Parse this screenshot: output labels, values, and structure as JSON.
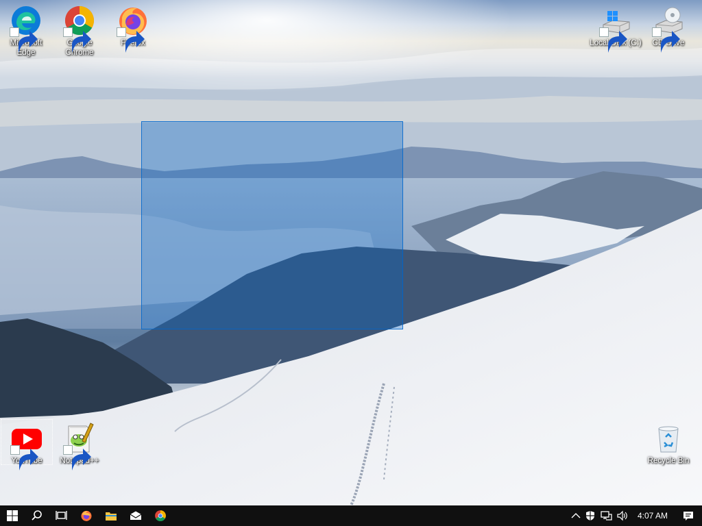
{
  "desktop": {
    "icons_top": [
      {
        "label": "Microsoft\nEdge",
        "icon": "edge-icon"
      },
      {
        "label": "Google\nChrome",
        "icon": "chrome-icon"
      },
      {
        "label": "Firefox",
        "icon": "firefox-icon"
      }
    ],
    "icons_right": [
      {
        "label": "Local Disk (C:)",
        "icon": "local-disk-icon"
      },
      {
        "label": "CD Drive",
        "icon": "cd-drive-icon"
      }
    ],
    "icons_bottom": [
      {
        "label": "YouTube",
        "icon": "youtube-icon"
      },
      {
        "label": "Notepad++",
        "icon": "notepad-plus-plus-icon"
      },
      {
        "label": "Recycle Bin",
        "icon": "recycle-bin-icon"
      }
    ]
  },
  "taskbar": {
    "clock": "4:07 AM",
    "pinned": [
      "start-icon",
      "search-icon",
      "task-view-icon",
      "firefox-icon",
      "file-explorer-icon",
      "mail-icon",
      "chrome-icon"
    ],
    "tray": [
      "chevron-up-icon",
      "security-icon",
      "network-icon",
      "volume-icon",
      "notification-icon"
    ]
  },
  "colors": {
    "selection": "#0066cc",
    "taskbar": "#101010",
    "youtube": "#ff0000",
    "edge": "#0c7bd8",
    "chrome_red": "#db4437",
    "chrome_yellow": "#f4b400",
    "chrome_green": "#0f9d58",
    "chrome_blue": "#4285f4"
  }
}
